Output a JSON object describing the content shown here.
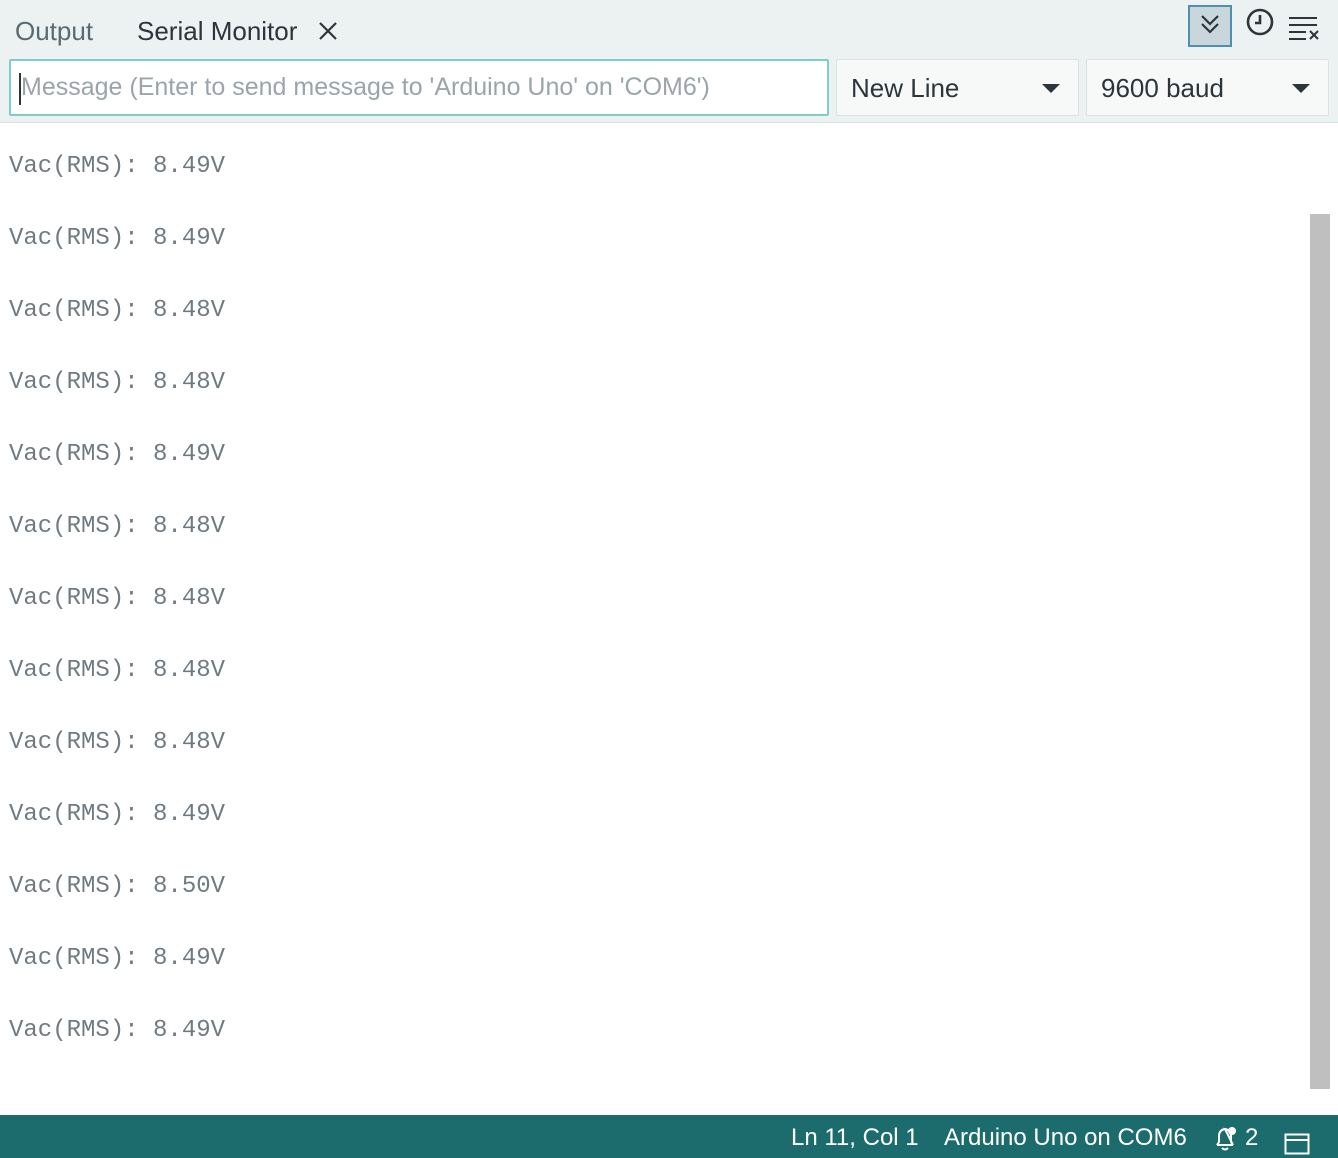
{
  "tabs": {
    "output_label": "Output",
    "serial_monitor_label": "Serial Monitor"
  },
  "toolbar": {
    "autoscroll_icon": "double-chevron-down-icon",
    "timestamp_icon": "clock-icon",
    "clear_icon": "clear-output-icon"
  },
  "message": {
    "value": "",
    "placeholder": "Message (Enter to send message to 'Arduino Uno' on 'COM6')"
  },
  "line_ending": {
    "selected": "New Line"
  },
  "baud_rate": {
    "selected": "9600 baud"
  },
  "output": {
    "lines": [
      "Vac(RMS): 8.49V",
      "Vac(RMS): 8.49V",
      "Vac(RMS): 8.48V",
      "Vac(RMS): 8.48V",
      "Vac(RMS): 8.49V",
      "Vac(RMS): 8.48V",
      "Vac(RMS): 8.48V",
      "Vac(RMS): 8.48V",
      "Vac(RMS): 8.48V",
      "Vac(RMS): 8.49V",
      "Vac(RMS): 8.50V",
      "Vac(RMS): 8.49V",
      "Vac(RMS): 8.49V"
    ]
  },
  "status_bar": {
    "cursor_position": "Ln 11, Col 1",
    "board": "Arduino Uno on COM6",
    "notification_count": "2",
    "bell_icon": "bell-notification-icon",
    "panel_icon": "toggle-panel-icon",
    "background_color": "#1c6c6e"
  }
}
